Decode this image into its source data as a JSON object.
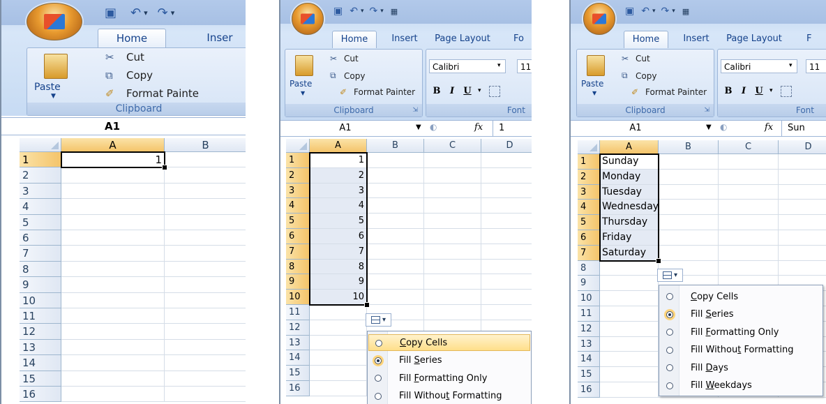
{
  "panels": [
    {
      "tabs": [
        "Home",
        "Inser"
      ],
      "clipboard": {
        "paste": "Paste",
        "cut": "Cut",
        "copy": "Copy",
        "format_painter": "Format Painte",
        "label": "Clipboard"
      },
      "name_box": "A1",
      "formula": "",
      "columns": [
        "A",
        "B"
      ],
      "rows": [
        "1",
        "2",
        "3",
        "4",
        "5",
        "6",
        "7",
        "8",
        "9",
        "10",
        "11",
        "12",
        "13",
        "14",
        "15",
        "16"
      ],
      "cells": {
        "A1": "1"
      }
    },
    {
      "tabs": [
        "Home",
        "Insert",
        "Page Layout",
        "Fo"
      ],
      "clipboard": {
        "paste": "Paste",
        "cut": "Cut",
        "copy": "Copy",
        "format_painter": "Format Painter",
        "label": "Clipboard"
      },
      "font": {
        "name": "Calibri",
        "size": "11",
        "bold": "B",
        "italic": "I",
        "underline": "U",
        "label": "Font"
      },
      "name_box": "A1",
      "fx": "fx",
      "formula": "1",
      "columns": [
        "A",
        "B",
        "C",
        "D"
      ],
      "rows": [
        "1",
        "2",
        "3",
        "4",
        "5",
        "6",
        "7",
        "8",
        "9",
        "10",
        "11",
        "12",
        "13",
        "14",
        "15",
        "16"
      ],
      "cells_a": [
        "1",
        "2",
        "3",
        "4",
        "5",
        "6",
        "7",
        "8",
        "9",
        "10"
      ],
      "menu": [
        "Copy Cells",
        "Fill Series",
        "Fill Formatting Only",
        "Fill Without Formatting"
      ]
    },
    {
      "tabs": [
        "Home",
        "Insert",
        "Page Layout",
        "F"
      ],
      "clipboard": {
        "paste": "Paste",
        "cut": "Cut",
        "copy": "Copy",
        "format_painter": "Format Painter",
        "label": "Clipboard"
      },
      "font": {
        "name": "Calibri",
        "size": "11",
        "bold": "B",
        "italic": "I",
        "underline": "U",
        "label": "Font"
      },
      "name_box": "A1",
      "fx": "fx",
      "formula": "Sun",
      "columns": [
        "A",
        "B",
        "C",
        "D"
      ],
      "rows": [
        "1",
        "2",
        "3",
        "4",
        "5",
        "6",
        "7",
        "8",
        "9",
        "10",
        "11",
        "12",
        "13",
        "14",
        "15",
        "16"
      ],
      "cells_a": [
        "Sunday",
        "Monday",
        "Tuesday",
        "Wednesday",
        "Thursday",
        "Friday",
        "Saturday"
      ],
      "menu": [
        "Copy Cells",
        "Fill Series",
        "Fill Formatting Only",
        "Fill Without Formatting",
        "Fill Days",
        "Fill Weekdays"
      ]
    }
  ],
  "colors": {
    "selected_header": "#f4c46a",
    "ribbon": "#d7e6f8",
    "menu_highlight": "#ffdf8a"
  }
}
